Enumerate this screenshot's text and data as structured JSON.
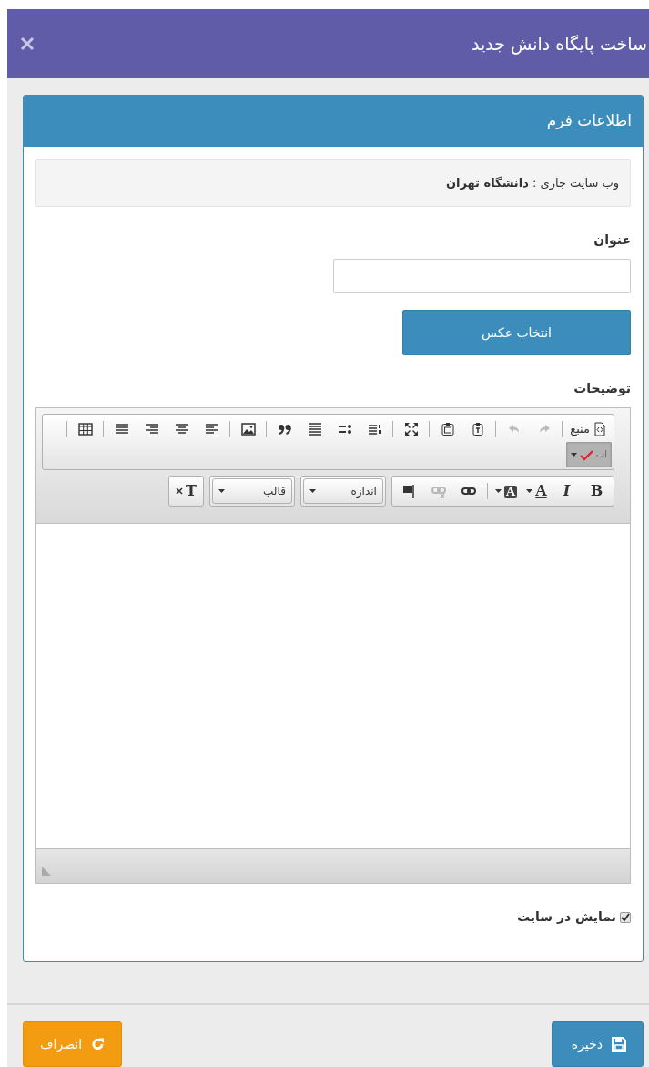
{
  "dialog": {
    "title": "ساخت پایگاه دانش جدید"
  },
  "panel": {
    "title": "اطلاعات فرم"
  },
  "current_site": {
    "label": "وب سایت جاری :",
    "value": "دانشگاه تهران"
  },
  "title_field": {
    "label": "عنوان"
  },
  "image_button": {
    "label": "انتخاب عکس"
  },
  "description": {
    "label": "توضیحات"
  },
  "toolbars": [
    {
      "sections": [
        [
          {
            "kind": "source",
            "label": "منبع",
            "disabled": false,
            "on": false
          }
        ],
        [
          {
            "kind": "redo",
            "disabled": true,
            "on": false
          },
          {
            "kind": "undo",
            "disabled": true,
            "on": false
          }
        ],
        [
          {
            "kind": "pastetext",
            "disabled": false,
            "on": false
          },
          {
            "kind": "pasteword",
            "disabled": false,
            "on": false
          }
        ],
        [
          {
            "kind": "maximize",
            "disabled": false,
            "on": false
          }
        ],
        [
          {
            "kind": "numberedlist",
            "disabled": false,
            "on": false
          },
          {
            "kind": "bulletedlist",
            "disabled": false,
            "on": false
          },
          {
            "kind": "hr",
            "disabled": false,
            "on": false
          },
          {
            "kind": "quote",
            "disabled": false,
            "on": false
          }
        ],
        [
          {
            "kind": "image",
            "disabled": false,
            "on": false
          }
        ],
        [
          {
            "kind": "alignleft",
            "disabled": false,
            "on": false
          },
          {
            "kind": "aligncenter",
            "disabled": false,
            "on": false
          },
          {
            "kind": "alignright",
            "disabled": false,
            "on": false
          },
          {
            "kind": "justify",
            "disabled": false,
            "on": false
          }
        ],
        [
          {
            "kind": "table",
            "disabled": false,
            "on": false
          }
        ],
        [
          {
            "kind": "spellcheck",
            "glyph": "اب",
            "disabled": false,
            "on": true
          }
        ]
      ]
    },
    {
      "sections": [
        [
          {
            "kind": "bold",
            "glyph": "B",
            "disabled": false,
            "on": false
          },
          {
            "kind": "italic",
            "glyph": "I",
            "disabled": false,
            "on": false
          },
          {
            "kind": "textcolor",
            "glyph": "A",
            "disabled": false,
            "on": false
          },
          {
            "kind": "bgcolor",
            "glyph": "A",
            "disabled": false,
            "on": false
          }
        ],
        [
          {
            "kind": "link",
            "disabled": false,
            "on": false
          },
          {
            "kind": "unlink",
            "disabled": true,
            "on": false
          },
          {
            "kind": "anchor",
            "disabled": false,
            "on": false
          }
        ]
      ]
    },
    {
      "sections": [
        [
          {
            "kind": "combo",
            "label": "اندازه",
            "disabled": false,
            "on": false
          }
        ]
      ]
    },
    {
      "sections": [
        [
          {
            "kind": "combo",
            "label": "قالب",
            "disabled": false,
            "on": false
          }
        ]
      ]
    },
    {
      "sections": [
        [
          {
            "kind": "removeformat",
            "glyph": "T",
            "disabled": false,
            "on": false
          }
        ]
      ]
    }
  ],
  "show_on_site": {
    "label": "نمایش در سایت",
    "checked": true
  },
  "footer": [
    {
      "kind": "save",
      "label": "ذخیره"
    },
    {
      "kind": "cancel",
      "label": "انصراف"
    }
  ]
}
